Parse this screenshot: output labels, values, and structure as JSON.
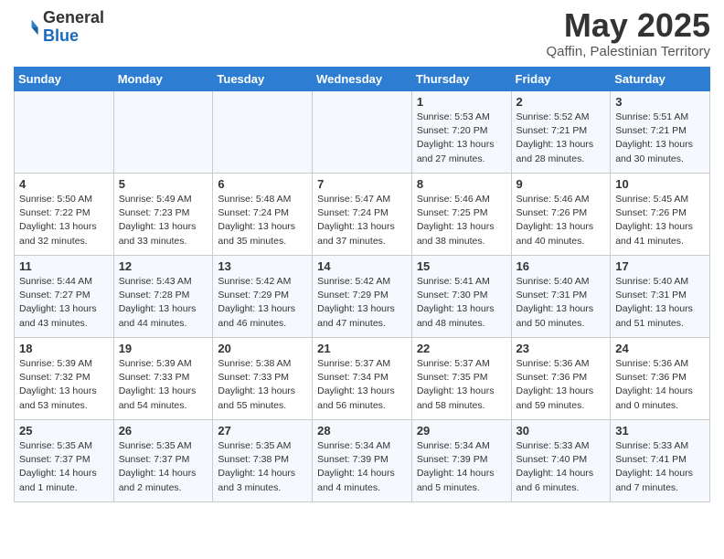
{
  "logo": {
    "general": "General",
    "blue": "Blue"
  },
  "header": {
    "month": "May 2025",
    "location": "Qaffin, Palestinian Territory"
  },
  "days_of_week": [
    "Sunday",
    "Monday",
    "Tuesday",
    "Wednesday",
    "Thursday",
    "Friday",
    "Saturday"
  ],
  "weeks": [
    [
      {
        "day": "",
        "info": ""
      },
      {
        "day": "",
        "info": ""
      },
      {
        "day": "",
        "info": ""
      },
      {
        "day": "",
        "info": ""
      },
      {
        "day": "1",
        "info": "Sunrise: 5:53 AM\nSunset: 7:20 PM\nDaylight: 13 hours\nand 27 minutes."
      },
      {
        "day": "2",
        "info": "Sunrise: 5:52 AM\nSunset: 7:21 PM\nDaylight: 13 hours\nand 28 minutes."
      },
      {
        "day": "3",
        "info": "Sunrise: 5:51 AM\nSunset: 7:21 PM\nDaylight: 13 hours\nand 30 minutes."
      }
    ],
    [
      {
        "day": "4",
        "info": "Sunrise: 5:50 AM\nSunset: 7:22 PM\nDaylight: 13 hours\nand 32 minutes."
      },
      {
        "day": "5",
        "info": "Sunrise: 5:49 AM\nSunset: 7:23 PM\nDaylight: 13 hours\nand 33 minutes."
      },
      {
        "day": "6",
        "info": "Sunrise: 5:48 AM\nSunset: 7:24 PM\nDaylight: 13 hours\nand 35 minutes."
      },
      {
        "day": "7",
        "info": "Sunrise: 5:47 AM\nSunset: 7:24 PM\nDaylight: 13 hours\nand 37 minutes."
      },
      {
        "day": "8",
        "info": "Sunrise: 5:46 AM\nSunset: 7:25 PM\nDaylight: 13 hours\nand 38 minutes."
      },
      {
        "day": "9",
        "info": "Sunrise: 5:46 AM\nSunset: 7:26 PM\nDaylight: 13 hours\nand 40 minutes."
      },
      {
        "day": "10",
        "info": "Sunrise: 5:45 AM\nSunset: 7:26 PM\nDaylight: 13 hours\nand 41 minutes."
      }
    ],
    [
      {
        "day": "11",
        "info": "Sunrise: 5:44 AM\nSunset: 7:27 PM\nDaylight: 13 hours\nand 43 minutes."
      },
      {
        "day": "12",
        "info": "Sunrise: 5:43 AM\nSunset: 7:28 PM\nDaylight: 13 hours\nand 44 minutes."
      },
      {
        "day": "13",
        "info": "Sunrise: 5:42 AM\nSunset: 7:29 PM\nDaylight: 13 hours\nand 46 minutes."
      },
      {
        "day": "14",
        "info": "Sunrise: 5:42 AM\nSunset: 7:29 PM\nDaylight: 13 hours\nand 47 minutes."
      },
      {
        "day": "15",
        "info": "Sunrise: 5:41 AM\nSunset: 7:30 PM\nDaylight: 13 hours\nand 48 minutes."
      },
      {
        "day": "16",
        "info": "Sunrise: 5:40 AM\nSunset: 7:31 PM\nDaylight: 13 hours\nand 50 minutes."
      },
      {
        "day": "17",
        "info": "Sunrise: 5:40 AM\nSunset: 7:31 PM\nDaylight: 13 hours\nand 51 minutes."
      }
    ],
    [
      {
        "day": "18",
        "info": "Sunrise: 5:39 AM\nSunset: 7:32 PM\nDaylight: 13 hours\nand 53 minutes."
      },
      {
        "day": "19",
        "info": "Sunrise: 5:39 AM\nSunset: 7:33 PM\nDaylight: 13 hours\nand 54 minutes."
      },
      {
        "day": "20",
        "info": "Sunrise: 5:38 AM\nSunset: 7:33 PM\nDaylight: 13 hours\nand 55 minutes."
      },
      {
        "day": "21",
        "info": "Sunrise: 5:37 AM\nSunset: 7:34 PM\nDaylight: 13 hours\nand 56 minutes."
      },
      {
        "day": "22",
        "info": "Sunrise: 5:37 AM\nSunset: 7:35 PM\nDaylight: 13 hours\nand 58 minutes."
      },
      {
        "day": "23",
        "info": "Sunrise: 5:36 AM\nSunset: 7:36 PM\nDaylight: 13 hours\nand 59 minutes."
      },
      {
        "day": "24",
        "info": "Sunrise: 5:36 AM\nSunset: 7:36 PM\nDaylight: 14 hours\nand 0 minutes."
      }
    ],
    [
      {
        "day": "25",
        "info": "Sunrise: 5:35 AM\nSunset: 7:37 PM\nDaylight: 14 hours\nand 1 minute."
      },
      {
        "day": "26",
        "info": "Sunrise: 5:35 AM\nSunset: 7:37 PM\nDaylight: 14 hours\nand 2 minutes."
      },
      {
        "day": "27",
        "info": "Sunrise: 5:35 AM\nSunset: 7:38 PM\nDaylight: 14 hours\nand 3 minutes."
      },
      {
        "day": "28",
        "info": "Sunrise: 5:34 AM\nSunset: 7:39 PM\nDaylight: 14 hours\nand 4 minutes."
      },
      {
        "day": "29",
        "info": "Sunrise: 5:34 AM\nSunset: 7:39 PM\nDaylight: 14 hours\nand 5 minutes."
      },
      {
        "day": "30",
        "info": "Sunrise: 5:33 AM\nSunset: 7:40 PM\nDaylight: 14 hours\nand 6 minutes."
      },
      {
        "day": "31",
        "info": "Sunrise: 5:33 AM\nSunset: 7:41 PM\nDaylight: 14 hours\nand 7 minutes."
      }
    ]
  ]
}
